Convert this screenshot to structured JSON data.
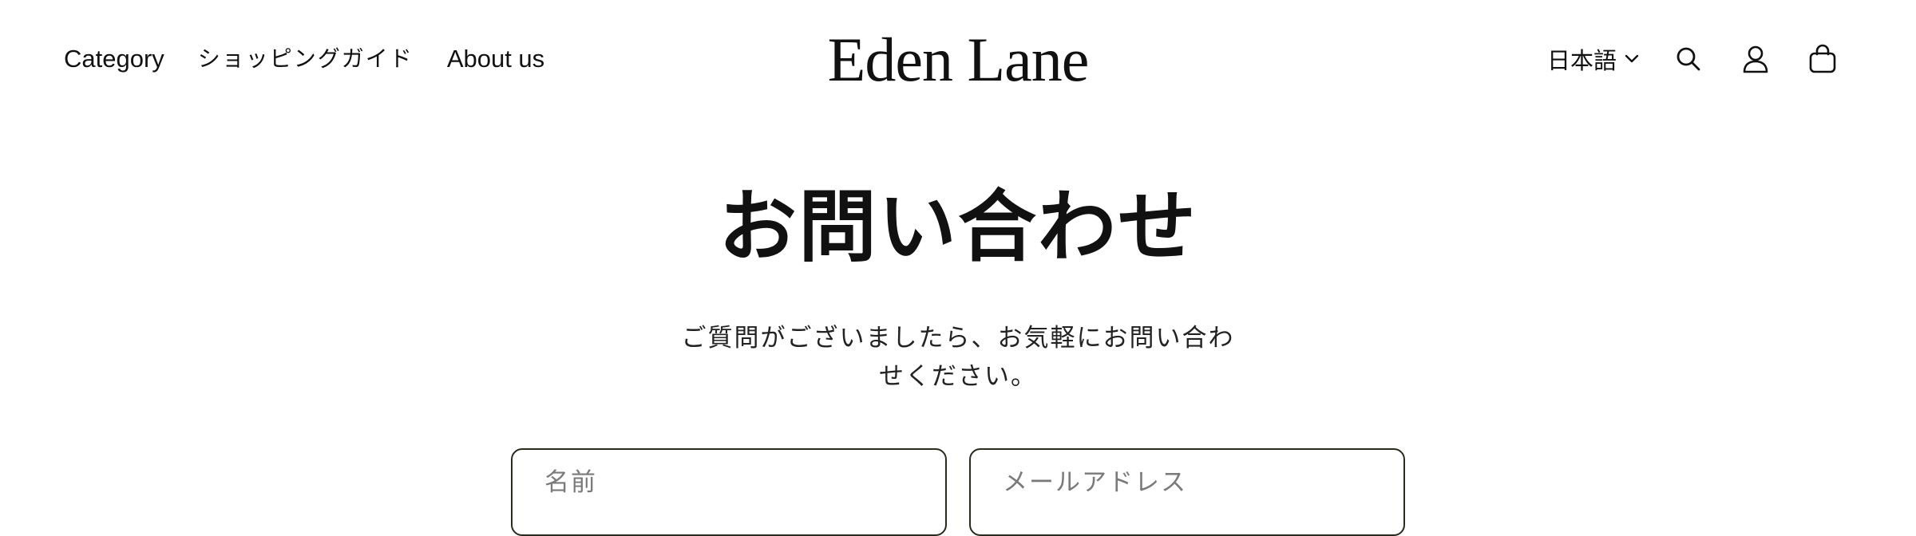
{
  "header": {
    "nav": [
      {
        "label": "Category"
      },
      {
        "label": "ショッピングガイド"
      },
      {
        "label": "About us"
      }
    ],
    "logo": "Eden Lane",
    "language": "日本語",
    "icons": {
      "lang_chevron": "chevron-down-icon",
      "search": "search-icon",
      "account": "user-icon",
      "cart": "bag-icon"
    }
  },
  "main": {
    "title": "お問い合わせ",
    "subtitle": "ご質問がございましたら、お気軽にお問い合わせください。",
    "form": {
      "name_placeholder": "名前",
      "name_value": "",
      "email_placeholder": "メールアドレス",
      "email_value": ""
    }
  },
  "colors": {
    "text": "#111111",
    "background": "#ffffff",
    "field_border": "#2a2a1f",
    "placeholder": "#7a7a7a"
  }
}
